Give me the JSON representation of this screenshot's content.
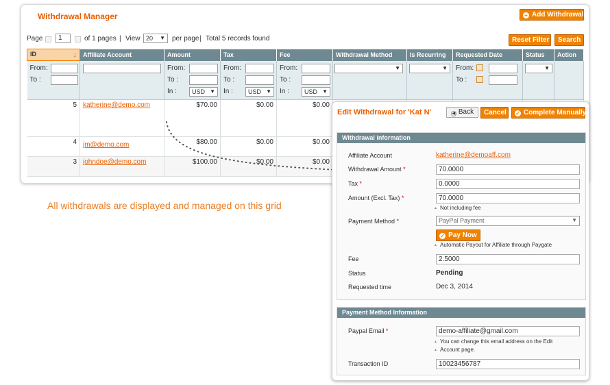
{
  "grid": {
    "title": "Withdrawal Manager",
    "add_button": "Add Withdrawal",
    "reset_filter": "Reset Filter",
    "search": "Search",
    "pager": {
      "page_label": "Page",
      "page_value": "1",
      "of_pages": "of 1 pages",
      "sep1": "|",
      "view_label": "View",
      "view_value": "20",
      "per_page": "per page",
      "sep2": "|",
      "total": "Total 5 records found"
    },
    "columns": [
      "ID",
      "Affiliate Account",
      "Amount",
      "Tax",
      "Fee",
      "Withdrawal Method",
      "Is Recurring",
      "Requested Date",
      "Status",
      "Action"
    ],
    "filter": {
      "from": "From:",
      "to": "To :",
      "in": "In :",
      "currency": "USD"
    },
    "rows": [
      {
        "id": "5",
        "account": "katherine@demo.com",
        "amount": "$70.00",
        "tax": "$0.00",
        "fee": "$0.00"
      },
      {
        "id": "4",
        "account": "jm@demo.com",
        "amount": "$80.00",
        "tax": "$0.00",
        "fee": "$0.00"
      },
      {
        "id": "3",
        "account": "johndoe@demo.com",
        "amount": "$100.00",
        "tax": "$0.00",
        "fee": "$0.00"
      }
    ]
  },
  "caption": "All withdrawals are displayed and managed on this grid",
  "edit": {
    "title": "Edit Withdrawal for 'Kat N'",
    "back": "Back",
    "cancel": "Cancel",
    "complete": "Complete Manually",
    "info_header": "Withdrawal information",
    "affiliate_label": "Affiliate Account",
    "affiliate_value": "katherine@demoaff.com",
    "amount_label": "Withdrawal Amount",
    "amount_value": "70.0000",
    "tax_label": "Tax",
    "tax_value": "0.0000",
    "excl_label": "Amount (Excl. Tax)",
    "excl_value": "70.0000",
    "excl_note": "Not including fee",
    "method_label": "Payment Method",
    "method_value": "PayPal Payment",
    "pay_now": "Pay Now",
    "pay_note": "Automatic Payout for Affiliate through Paygate",
    "fee_label": "Fee",
    "fee_value": "2.5000",
    "status_label": "Status",
    "status_value": "Pending",
    "requested_label": "Requested time",
    "requested_value": "Dec 3, 2014",
    "req_mark": "*",
    "pm_header": "Payment Method Information",
    "paypal_label": "Paypal Email",
    "paypal_value": "demo-affiliate@gmail.com",
    "paypal_note_1": "You can change this email address on the Edit",
    "paypal_note_2": "Account page.",
    "txn_label": "Transaction ID",
    "txn_value": "10023456787"
  },
  "colors": {
    "accent": "#eb5e00",
    "button": "#f18200",
    "header": "#6f8992",
    "filter_bg": "#e3edf0"
  },
  "icons": {
    "sort": "sort-down-arrow",
    "add": "plus-circle-icon",
    "back": "back-circle-icon",
    "complete": "check-circle-icon",
    "pay": "check-circle-icon",
    "calendar": "calendar-icon"
  }
}
